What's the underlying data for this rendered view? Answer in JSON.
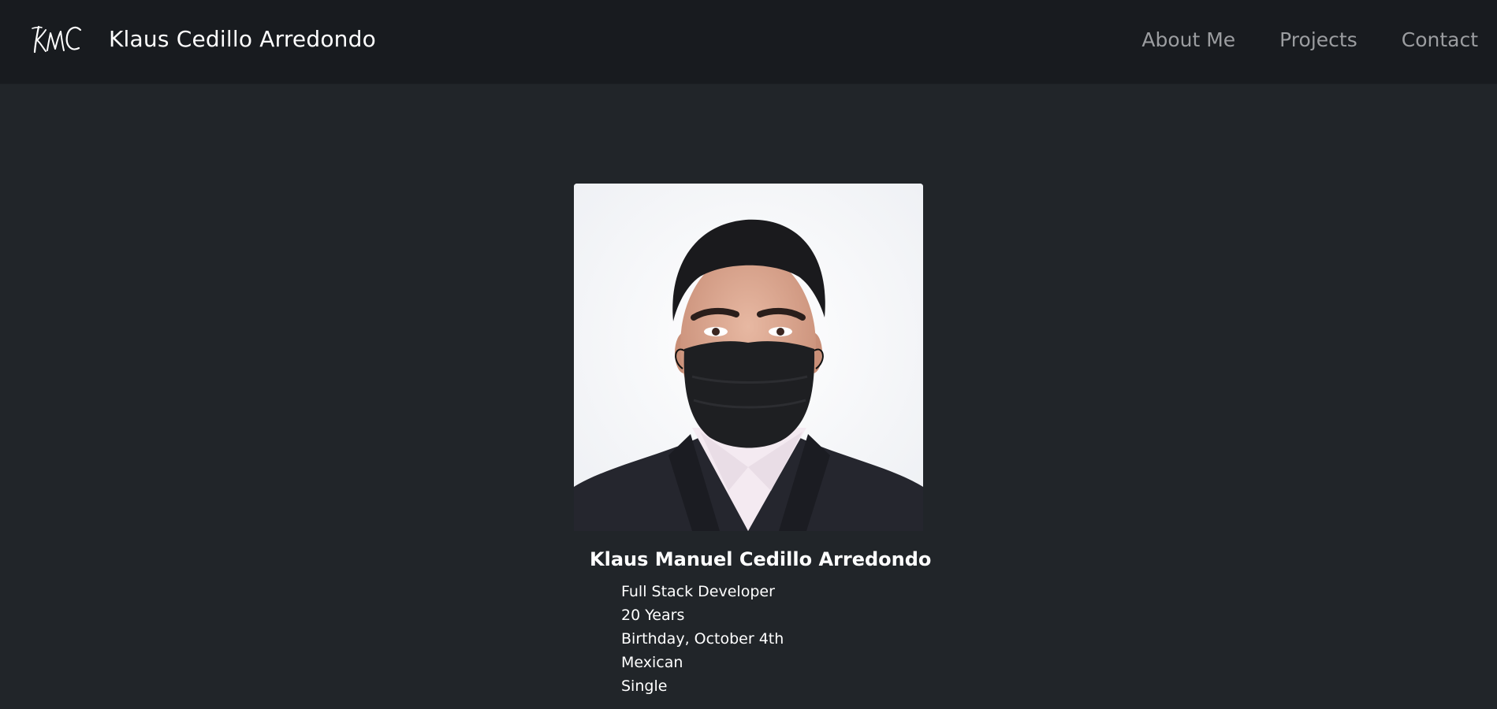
{
  "header": {
    "logo_text": "KMC",
    "brand_name": "Klaus Cedillo Arredondo",
    "nav": [
      {
        "label": "About Me"
      },
      {
        "label": "Projects"
      },
      {
        "label": "Contact"
      }
    ]
  },
  "profile": {
    "full_name": "Klaus Manuel Cedillo Arredondo",
    "details": [
      "Full Stack Developer",
      "20 Years",
      "Birthday, October 4th",
      "Mexican",
      "Single"
    ]
  },
  "colors": {
    "page_bg": "#212529",
    "navbar_bg": "#181b1f",
    "nav_link": "#9b9da0",
    "text": "#ffffff"
  }
}
